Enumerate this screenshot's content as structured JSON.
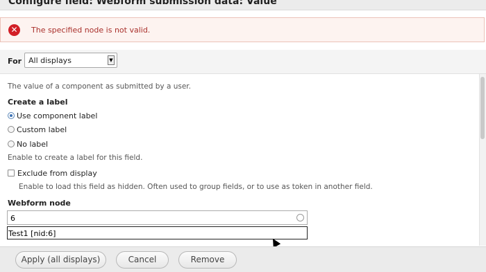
{
  "dialog": {
    "title": "Configure field: Webform submission data: Value"
  },
  "error": {
    "icon": "error-x-icon",
    "message": "The specified node is not valid."
  },
  "for_bar": {
    "label": "For",
    "select_value": "All displays"
  },
  "form": {
    "description": "The value of a component as submitted by a user.",
    "create_label_heading": "Create a label",
    "label_options": [
      {
        "label": "Use component label",
        "selected": true
      },
      {
        "label": "Custom label",
        "selected": false
      },
      {
        "label": "No label",
        "selected": false
      }
    ],
    "label_help": "Enable to create a label for this field.",
    "exclude_label": "Exclude from display",
    "exclude_checked": false,
    "exclude_help": "Enable to load this field as hidden. Often used to group fields, or to use as token in another field.",
    "webform_node_heading": "Webform node",
    "webform_node_value": "6",
    "autocomplete_suggestion": "Test1 [nid:6]"
  },
  "buttons": {
    "apply": "Apply (all displays)",
    "cancel": "Cancel",
    "remove": "Remove"
  },
  "colors": {
    "error_text": "#a9302b",
    "error_bg": "#fdf3f0",
    "error_icon": "#d21f26"
  }
}
